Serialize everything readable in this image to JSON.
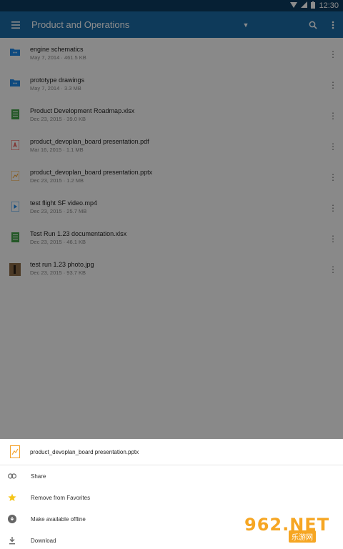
{
  "status_bar": {
    "time": "12:30"
  },
  "app_bar": {
    "title": "Product and Operations"
  },
  "files": [
    {
      "name": "engine schematics",
      "meta": "May 7, 2014 · 461.5 KB",
      "icon": "shared-folder-icon"
    },
    {
      "name": "prototype drawings",
      "meta": "May 7, 2014 · 3.3 MB",
      "icon": "shared-folder-icon"
    },
    {
      "name": "Product Development Roadmap.xlsx",
      "meta": "Dec 23, 2015 · 39.0 KB",
      "icon": "spreadsheet-icon"
    },
    {
      "name": "product_devoplan_board presentation.pdf",
      "meta": "Mar 16, 2015 · 1.1 MB",
      "icon": "pdf-icon"
    },
    {
      "name": "product_devoplan_board presentation.pptx",
      "meta": "Dec 23, 2015 · 1.2 MB",
      "icon": "presentation-icon"
    },
    {
      "name": "test flight SF video.mp4",
      "meta": "Dec 23, 2015 · 25.7 MB",
      "icon": "video-icon"
    },
    {
      "name": "Test Run 1.23 documentation.xlsx",
      "meta": "Dec 23, 2015 · 46.1 KB",
      "icon": "spreadsheet-icon"
    },
    {
      "name": "test run 1.23 photo.jpg",
      "meta": "Dec 23, 2015 · 93.7 KB",
      "icon": "photo-thumbnail"
    }
  ],
  "sheet": {
    "title": "product_devoplan_board presentation.pptx",
    "actions": [
      {
        "label": "Share",
        "icon": "link-icon"
      },
      {
        "label": "Remove from Favorites",
        "icon": "star-icon"
      },
      {
        "label": "Make available offline",
        "icon": "offline-download-icon"
      },
      {
        "label": "Download",
        "icon": "download-icon"
      }
    ]
  },
  "watermark": {
    "main": "962.NET",
    "sub": "乐游网"
  },
  "colors": {
    "app_bar": "#1b6aa4",
    "status_bar": "#0b3b5f",
    "folder": "#1e88e5",
    "sheet_green": "#43a047",
    "pdf_red": "#e53935",
    "ppt_orange": "#f4a12b",
    "star": "#f5c518"
  }
}
